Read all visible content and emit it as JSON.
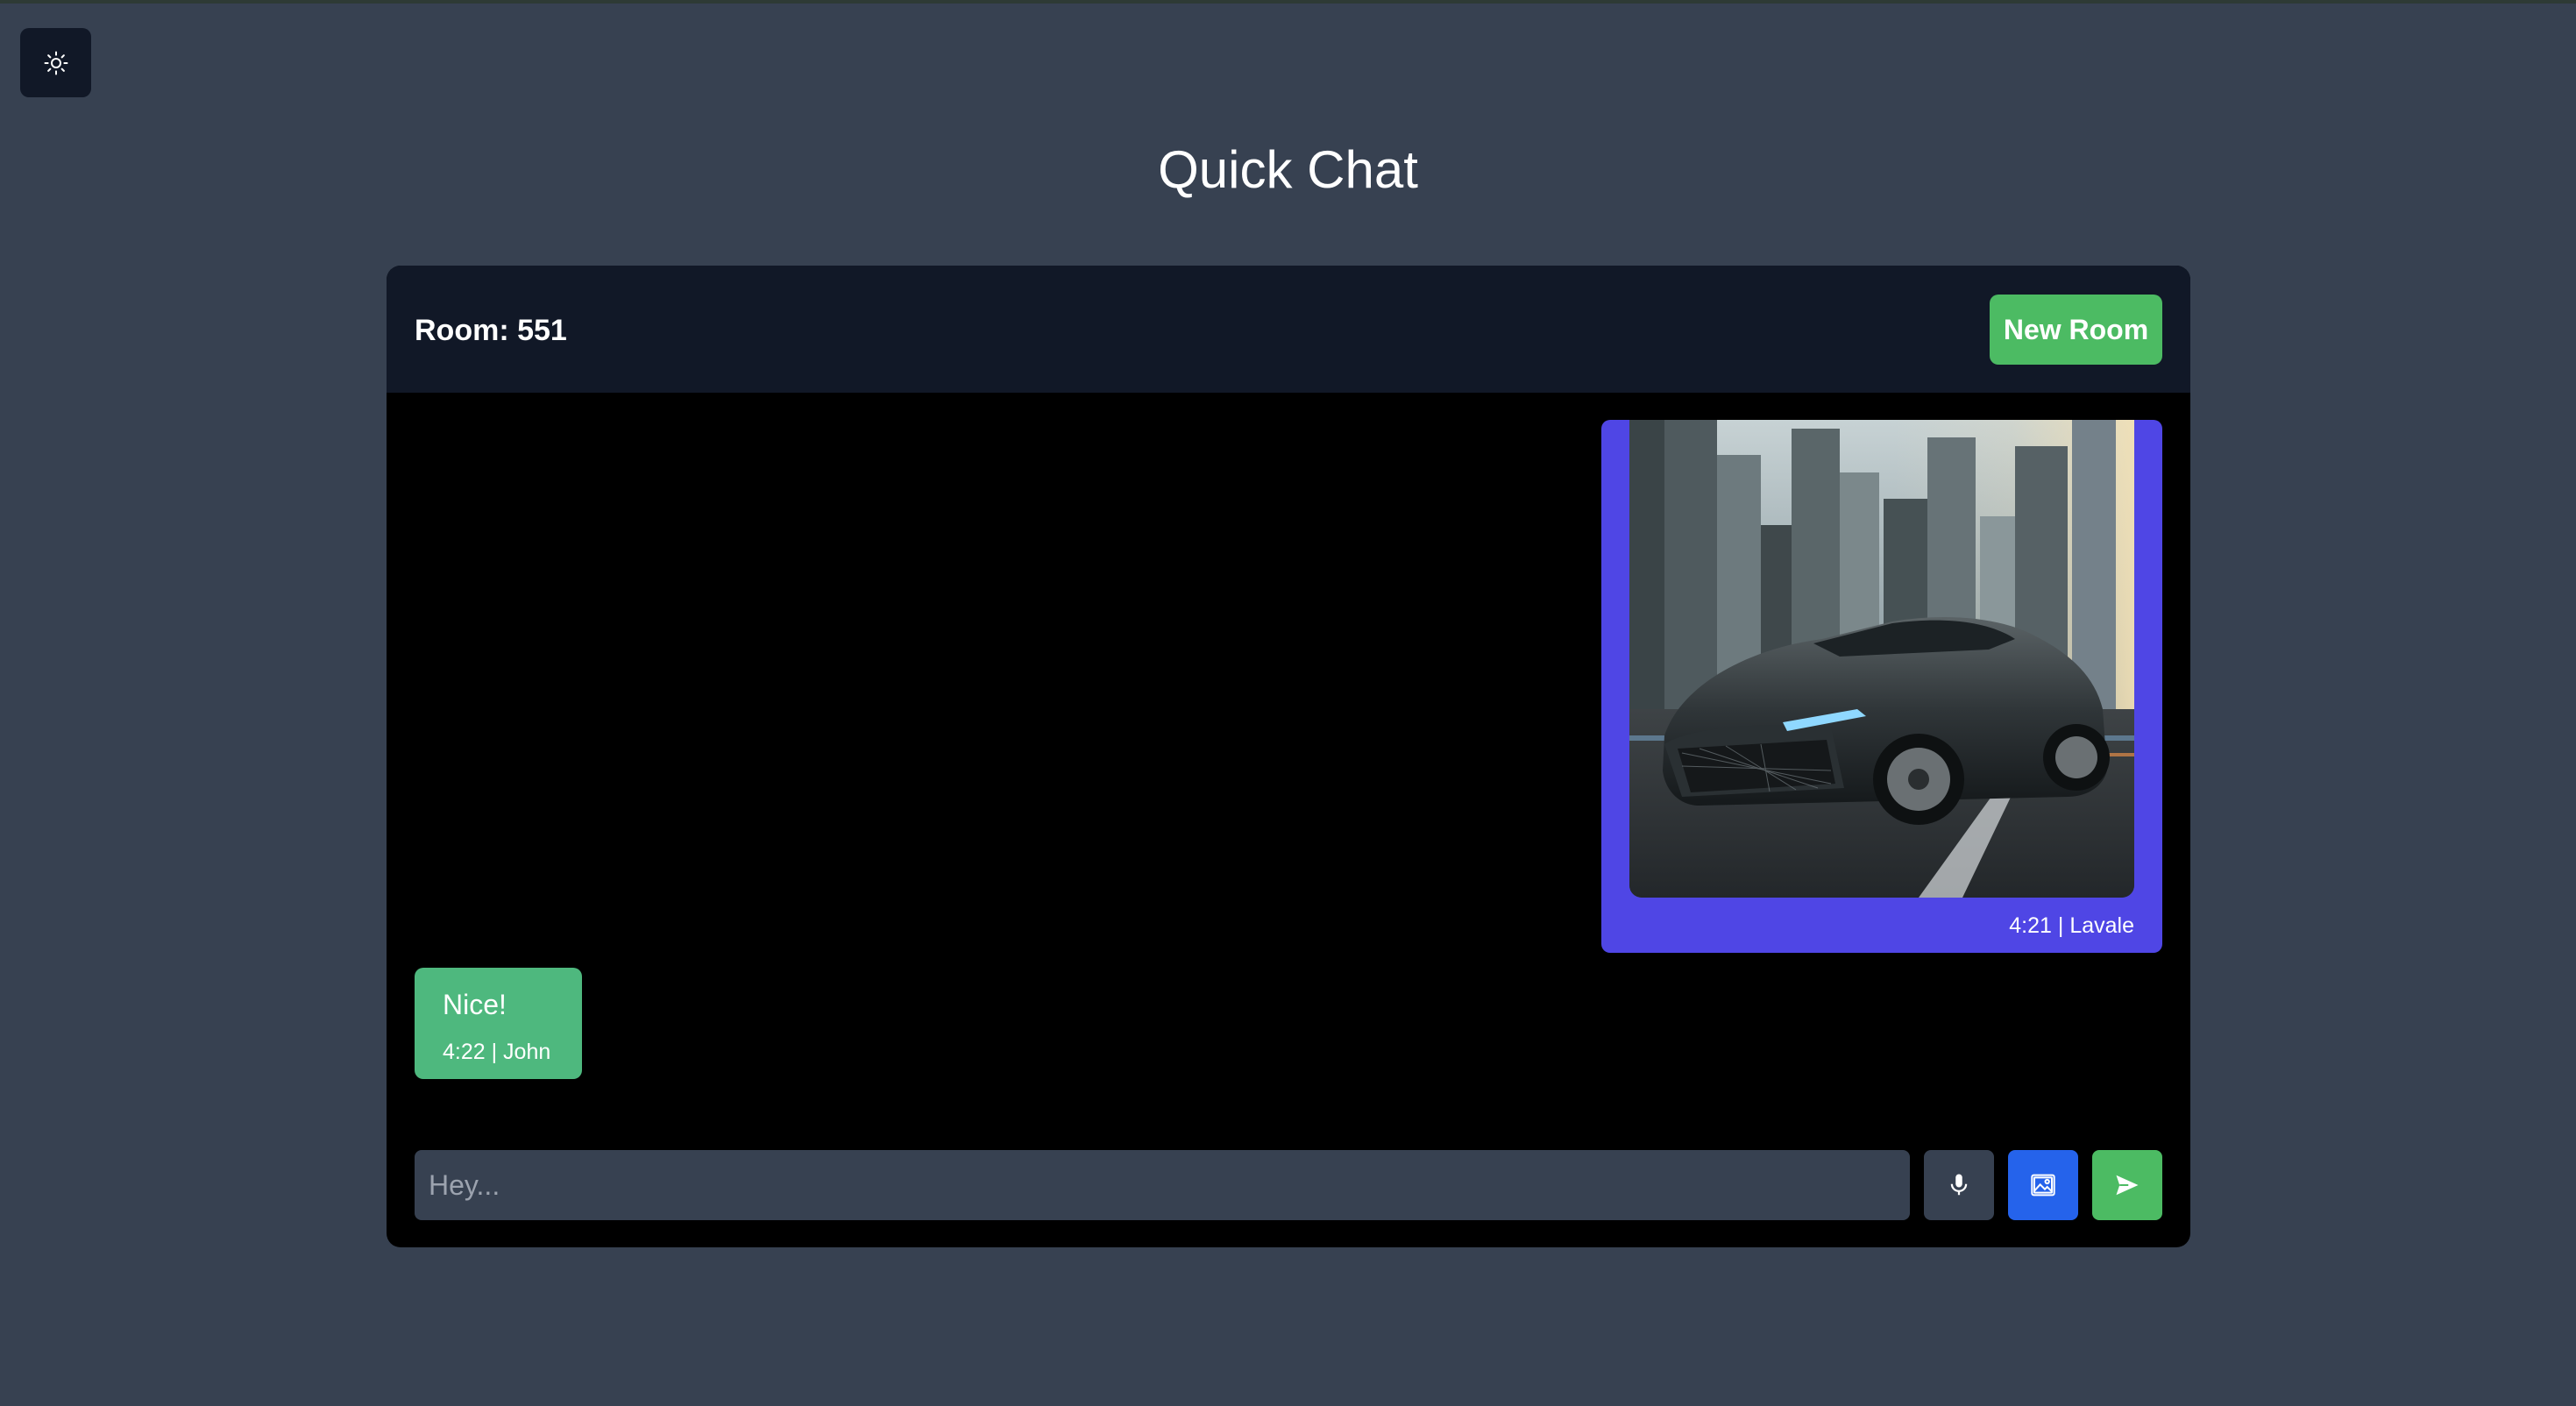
{
  "page": {
    "title": "Quick Chat"
  },
  "theme_toggle": {
    "icon": "sun-icon"
  },
  "room": {
    "label": "Room: 551",
    "new_room_label": "New Room"
  },
  "messages": [
    {
      "type": "image",
      "image_subject": "car-city-image",
      "meta": "4:21 | Lavale",
      "align": "right",
      "color": "#4f46e5"
    },
    {
      "type": "text",
      "text": "Nice!",
      "meta": "4:22 | John",
      "align": "left",
      "color": "#4eb87e"
    }
  ],
  "composer": {
    "placeholder": "Hey...",
    "value": "",
    "mic_icon": "microphone-icon",
    "image_icon": "image-icon",
    "send_icon": "send-icon"
  },
  "colors": {
    "background": "#374151",
    "card": "#000000",
    "header": "#111827",
    "accent_green": "#4cbb63",
    "accent_blue": "#2563eb",
    "accent_indigo": "#4f46e5"
  }
}
